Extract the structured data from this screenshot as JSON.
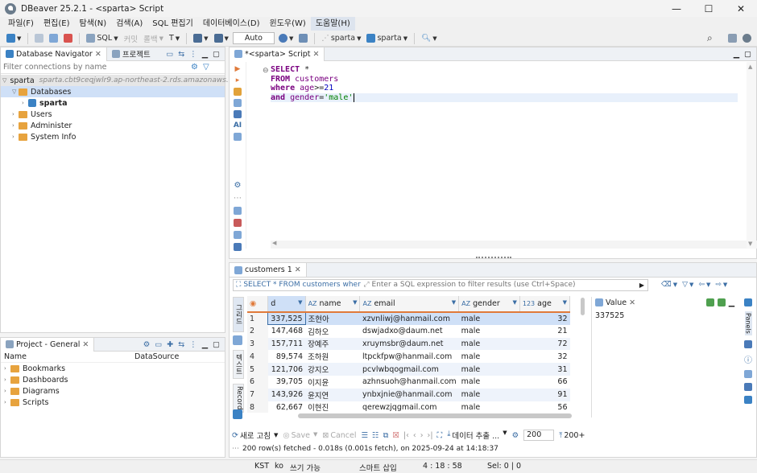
{
  "window": {
    "title": "DBeaver 25.2.1 - <sparta> Script",
    "minimize": "—",
    "maximize": "☐",
    "close": "✕"
  },
  "menu": [
    "파일(F)",
    "편집(E)",
    "탐색(N)",
    "검색(A)",
    "SQL 편집기",
    "데이터베이스(D)",
    "윈도우(W)",
    "도움말(H)"
  ],
  "toolbar": {
    "sql": "SQL",
    "commit": "커밋",
    "rollback": "롤백",
    "auto": "Auto",
    "datasource": "sparta",
    "schema": "sparta"
  },
  "navigator": {
    "tab_label": "Database Navigator",
    "project_tab": "프로젝트",
    "filter_placeholder": "Filter connections by name",
    "connection": "sparta",
    "connection_host": "sparta.cbt9ceqjwlr9.ap-northeast-2.rds.amazonaws.co...",
    "items": [
      "Databases",
      "sparta",
      "Users",
      "Administer",
      "System Info"
    ]
  },
  "project": {
    "tab_label": "Project - General",
    "col_name": "Name",
    "col_datasource": "DataSource",
    "items": [
      "Bookmarks",
      "Dashboards",
      "Diagrams",
      "Scripts"
    ]
  },
  "editor": {
    "tab_label": "*<sparta> Script",
    "lines": [
      [
        "SELECT ",
        "*"
      ],
      [
        "FROM ",
        "customers"
      ],
      [
        "where ",
        "age",
        ">=",
        "21"
      ],
      [
        "and ",
        "gender",
        "=",
        "'male'"
      ]
    ]
  },
  "results": {
    "tab_label": "customers 1",
    "filter_sql": "SELECT * FROM customers where ag",
    "filter_placeholder": "Enter a SQL expression to filter results (use Ctrl+Space)",
    "side_tabs": [
      "그리드",
      "텍스트",
      "Record"
    ],
    "columns": [
      "d",
      "name",
      "email",
      "gender",
      "age"
    ],
    "col_prefix": [
      "",
      "AZ",
      "AZ",
      "AZ",
      "123"
    ],
    "rows": [
      [
        "1",
        "337,525",
        "조현아",
        "xzvnliwj@hanmail.com",
        "male",
        "32"
      ],
      [
        "2",
        "147,468",
        "김하오",
        "dswjadxo@daum.net",
        "male",
        "21"
      ],
      [
        "3",
        "157,711",
        "장예주",
        "xruymsbr@daum.net",
        "male",
        "72"
      ],
      [
        "4",
        "89,574",
        "조하원",
        "ltpckfpw@hanmail.com",
        "male",
        "32"
      ],
      [
        "5",
        "121,706",
        "강지오",
        "pcvlwbqogmail.com",
        "male",
        "31"
      ],
      [
        "6",
        "39,705",
        "이지윤",
        "azhnsuoh@hanmail.com",
        "male",
        "66"
      ],
      [
        "7",
        "143,926",
        "윤지연",
        "ynbxjnie@hanmail.com",
        "male",
        "91"
      ],
      [
        "8",
        "62,667",
        "이현진",
        "qerewzjqgmail.com",
        "male",
        "56"
      ]
    ],
    "value_panel_title": "Value",
    "value": "337525",
    "panels_label": "Panels",
    "bottom": {
      "refresh": "새로 고침",
      "save": "Save",
      "cancel": "Cancel",
      "export": "데이터 추출 ...",
      "fetch_size": "200",
      "fetch_more": "200+"
    },
    "status_msg": "200 row(s) fetched - 0.018s (0.001s fetch), on 2025-09-24 at 14:18:37"
  },
  "statusbar": [
    "KST",
    "ko",
    "쓰기 가능",
    "스마트 삽입",
    "4 : 18 : 58",
    "Sel: 0 | 0"
  ],
  "colors": {
    "accent": "#e07a3a",
    "selection": "#cfe0f7",
    "keyword": "#7a0080",
    "string": "#008000"
  }
}
